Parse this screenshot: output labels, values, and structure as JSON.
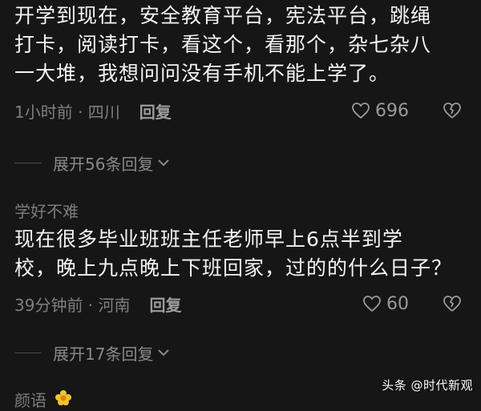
{
  "comments": [
    {
      "lines": [
        "开学到现在，安全教育平台，宪法平台，跳绳",
        "打卡，阅读打卡，看这个，看那个，杂七杂八",
        "一大堆，我想问问没有手机不能上学了。"
      ],
      "time_location": "1小时前 · 四川",
      "reply_label": "回复",
      "likes": "696",
      "expand_label": "展开56条回复"
    },
    {
      "username": "学好不难",
      "lines": [
        "现在很多毕业班班主任老师早上6点半到学",
        "校，晚上九点晚上下班回家，过的的什么日子？"
      ],
      "time_location": "39分钟前 · 河南",
      "reply_label": "回复",
      "likes": "60",
      "expand_label": "展开17条回复"
    },
    {
      "username": "颜语"
    }
  ],
  "watermark": "头条 @时代新观"
}
